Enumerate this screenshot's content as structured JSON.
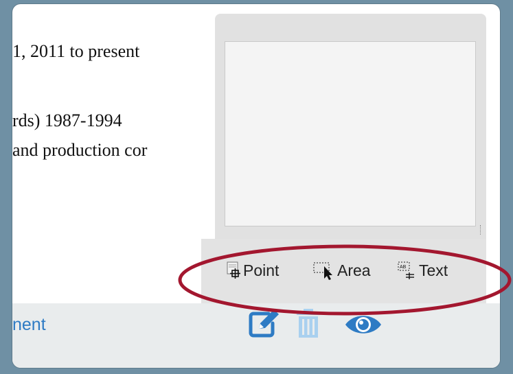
{
  "document": {
    "lines": [
      "1, 2011 to present",
      "rds) 1987-1994",
      "and production cor"
    ]
  },
  "annotation_popup": {
    "textarea_value": "",
    "tools": [
      {
        "icon": "point-tool-icon",
        "label": "Point"
      },
      {
        "icon": "area-select-icon",
        "label": "Area"
      },
      {
        "icon": "text-select-icon",
        "label": "Text"
      }
    ]
  },
  "bottom_bar": {
    "link_text": "nent",
    "icons": [
      "edit-icon",
      "trash-icon",
      "eye-icon"
    ]
  },
  "colors": {
    "background": "#6f90a4",
    "accent_blue": "#2e7bc4",
    "highlight_red": "#a3172f"
  }
}
